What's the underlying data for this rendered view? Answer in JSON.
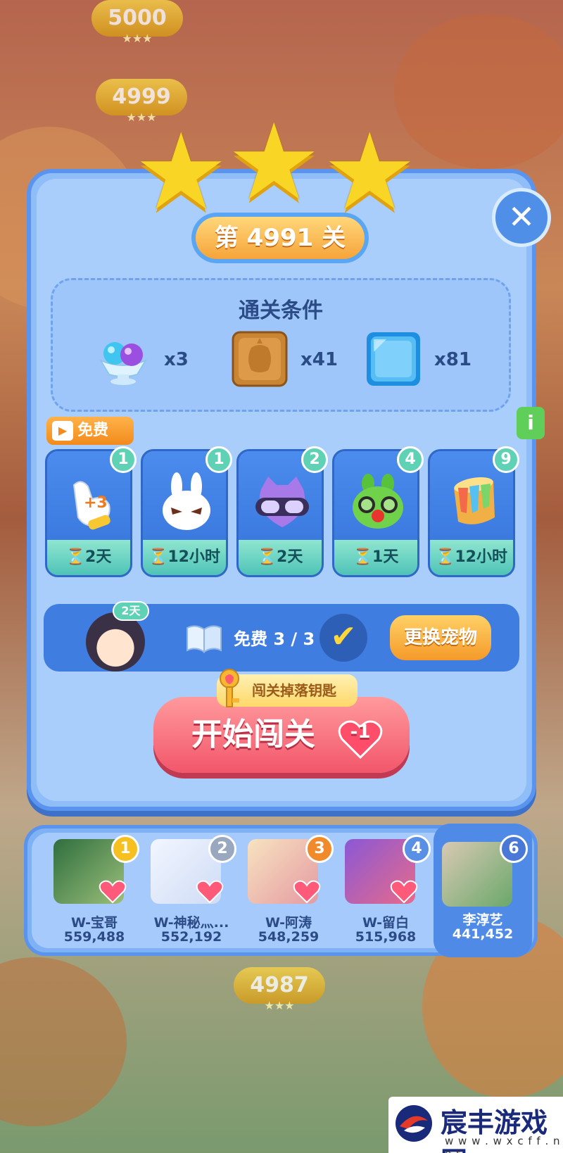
{
  "background": {
    "coins": [
      {
        "text": "5000"
      },
      {
        "text": "4999"
      },
      {
        "text": "4987"
      }
    ]
  },
  "level": {
    "stars": 3,
    "title": "第 4991 关"
  },
  "goals": {
    "title": "通关条件",
    "items": [
      {
        "icon": "ice-cream-cup-icon",
        "count": "x3"
      },
      {
        "icon": "wooden-crate-icon",
        "count": "x41"
      },
      {
        "icon": "ice-block-icon",
        "count": "x81"
      }
    ]
  },
  "free_tag": {
    "label": "免费"
  },
  "info_tab": {
    "label": "i"
  },
  "boosters": [
    {
      "icon": "glove-plus3-icon",
      "count": "1",
      "timer": "⏳2天"
    },
    {
      "icon": "white-rabbit-icon",
      "count": "1",
      "timer": "⏳12小时"
    },
    {
      "icon": "purple-cat-goggles-icon",
      "count": "2",
      "timer": "⏳2天"
    },
    {
      "icon": "green-frog-icon",
      "count": "4",
      "timer": "⏳1天"
    },
    {
      "icon": "paint-bucket-icon",
      "count": "9",
      "timer": "⏳12小时"
    }
  ],
  "pet": {
    "days": "2天",
    "free_text": "免费 3 / 3",
    "change_label": "更换宠物"
  },
  "start": {
    "ribbon": "闯关掉落钥匙",
    "label": "开始闯关",
    "cost": "-1"
  },
  "leaderboard": [
    {
      "rank": "1",
      "name": "W-宝哥",
      "score": "559,488"
    },
    {
      "rank": "2",
      "name": "W-神秘灬...",
      "score": "552,192"
    },
    {
      "rank": "3",
      "name": "W-阿涛",
      "score": "548,259"
    },
    {
      "rank": "4",
      "name": "W-留白",
      "score": "515,968"
    },
    {
      "rank": "6",
      "name": "李淳艺",
      "score": "441,452"
    }
  ],
  "watermark": {
    "name": "宸丰游戏网",
    "url": "w w w . w x c f f . n e t"
  },
  "colors": {
    "panel": "#a9cefb",
    "accent_orange": "#f6a43a",
    "start_pink": "#f2566b"
  }
}
